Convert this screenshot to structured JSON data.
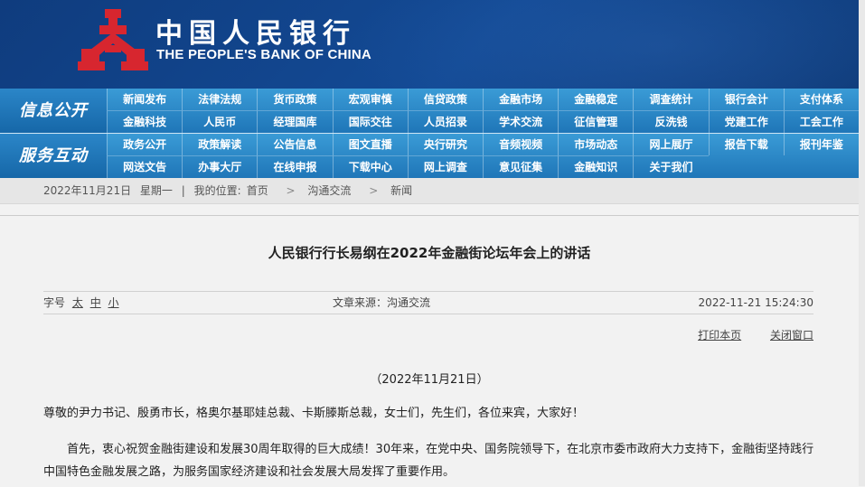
{
  "header": {
    "brand_cn": "中国人民银行",
    "brand_en": "THE PEOPLE'S BANK OF CHINA",
    "logo_icon": "pboc-logo-icon",
    "logo_color": "#d7262f"
  },
  "nav": {
    "group1_title": "信息公开",
    "group1_items": [
      "新闻发布",
      "法律法规",
      "货币政策",
      "宏观审慎",
      "信贷政策",
      "金融市场",
      "金融稳定",
      "调查统计",
      "银行会计",
      "支付体系",
      "金融科技",
      "人民币",
      "经理国库",
      "国际交往",
      "人员招录",
      "学术交流",
      "征信管理",
      "反洗钱",
      "党建工作",
      "工会工作"
    ],
    "group2_title": "服务互动",
    "group2_items": [
      "政务公开",
      "政策解读",
      "公告信息",
      "图文直播",
      "央行研究",
      "音频视频",
      "市场动态",
      "网上展厅",
      "报告下载",
      "报刊年鉴",
      "网送文告",
      "办事大厅",
      "在线申报",
      "下载中心",
      "网上调查",
      "意见征集",
      "金融知识",
      "关于我们"
    ]
  },
  "breadcrumb": {
    "date": "2022年11月21日",
    "weekday": "星期一",
    "location_label": "我的位置:",
    "home": "首页",
    "level1": "沟通交流",
    "level2": "新闻",
    "separator": ">"
  },
  "article": {
    "title": "人民银行行长易纲在2022年金融街论坛年会上的讲话",
    "font_size_label": "字号",
    "font_large": "太",
    "font_medium": "中",
    "font_small": "小",
    "source": "文章来源：沟通交流",
    "timestamp": "2022-11-21  15:24:30",
    "print_label": "打印本页",
    "close_label": "关闭窗口",
    "date_line": "（2022年11月21日）",
    "para1": "尊敬的尹力书记、殷勇市长，格奥尔基耶娃总裁、卡斯滕斯总裁，女士们，先生们，各位来宾，大家好！",
    "para2": "首先，衷心祝贺金融街建设和发展30周年取得的巨大成绩！30年来，在党中央、国务院领导下，在北京市委市政府大力支持下，金融街坚持践行中国特色金融发展之路，为服务国家经济建设和社会发展大局发挥了重要作用。"
  }
}
